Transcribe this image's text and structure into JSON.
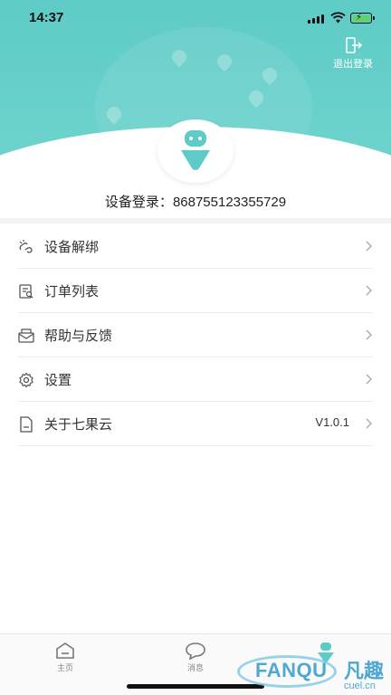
{
  "status_bar": {
    "time": "14:37"
  },
  "header": {
    "logout_label": "退出登录"
  },
  "profile": {
    "device_label": "设备登录：",
    "device_id": "868755123355729"
  },
  "menu": {
    "items": [
      {
        "icon": "unbind-icon",
        "label": "设备解绑",
        "value": ""
      },
      {
        "icon": "order-list-icon",
        "label": "订单列表",
        "value": ""
      },
      {
        "icon": "help-feedback-icon",
        "label": "帮助与反馈",
        "value": ""
      },
      {
        "icon": "settings-gear-icon",
        "label": "设置",
        "value": ""
      },
      {
        "icon": "about-icon",
        "label": "关于七果云",
        "value": "V1.0.1"
      }
    ]
  },
  "tabbar": {
    "tabs": [
      {
        "icon": "home-icon",
        "label": "主页"
      },
      {
        "icon": "message-icon",
        "label": "消息"
      },
      {
        "icon": "profile-icon",
        "label": ""
      }
    ]
  },
  "watermark": {
    "brand": "FANQU",
    "brand_cn": "凡趣",
    "domain": "cuel.cn"
  },
  "colors": {
    "accent": "#5fcbc6",
    "text": "#333333",
    "divider": "#ececec"
  }
}
